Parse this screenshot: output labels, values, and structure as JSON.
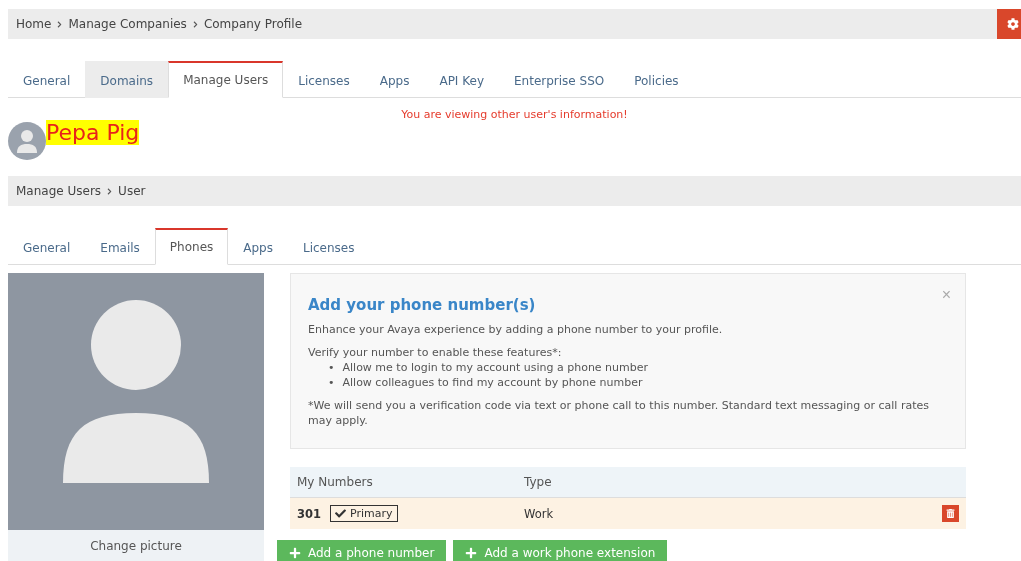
{
  "breadcrumb": [
    "Home",
    "Manage Companies",
    "Company Profile"
  ],
  "tabs": [
    {
      "label": "General",
      "selected": false,
      "highlighted": false
    },
    {
      "label": "Domains",
      "selected": false,
      "highlighted": true
    },
    {
      "label": "Manage Users",
      "selected": true,
      "highlighted": false
    },
    {
      "label": "Licenses",
      "selected": false,
      "highlighted": false
    },
    {
      "label": "Apps",
      "selected": false,
      "highlighted": false
    },
    {
      "label": "API Key",
      "selected": false,
      "highlighted": false
    },
    {
      "label": "Enterprise SSO",
      "selected": false,
      "highlighted": false
    },
    {
      "label": "Policies",
      "selected": false,
      "highlighted": false
    }
  ],
  "warning": "You are viewing other user's information!",
  "user_name": "Pepa Pig",
  "sub_breadcrumb": [
    "Manage Users",
    "User"
  ],
  "sub_tabs": [
    {
      "label": "General",
      "selected": false
    },
    {
      "label": "Emails",
      "selected": false
    },
    {
      "label": "Phones",
      "selected": true
    },
    {
      "label": "Apps",
      "selected": false
    },
    {
      "label": "Licenses",
      "selected": false
    }
  ],
  "change_picture": "Change picture",
  "info": {
    "title": "Add your phone number(s)",
    "intro": "Enhance your Avaya experience by adding a phone number to your profile.",
    "features_heading": "Verify your number to enable these features*:",
    "bullet": "•",
    "features": [
      "Allow me to login to my account using a phone number",
      "Allow colleagues to find my account by phone number"
    ],
    "note": "*We will send you a verification code via text or phone call to this number. Standard text messaging or call rates may apply.",
    "close": "×"
  },
  "table": {
    "columns": [
      "My Numbers",
      "Type"
    ],
    "rows": [
      {
        "number": "301",
        "primary": true,
        "primary_label": "Primary",
        "type": "Work"
      }
    ]
  },
  "buttons": [
    "Add a phone number",
    "Add a work phone extension"
  ]
}
